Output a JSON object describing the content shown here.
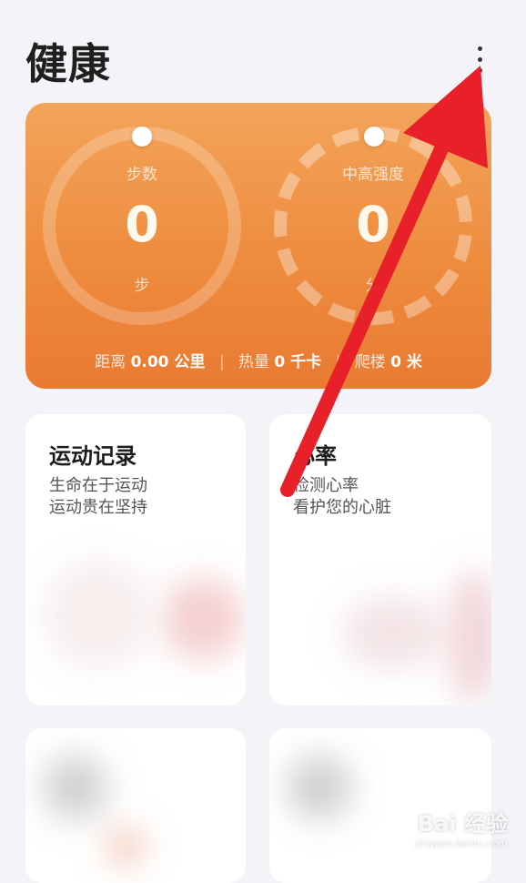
{
  "header": {
    "title": "健康"
  },
  "summary": {
    "steps": {
      "label": "步数",
      "value": "0",
      "unit": "步"
    },
    "intense": {
      "label": "中高强度",
      "value": "0",
      "unit": "分"
    },
    "stats": {
      "distance_label": "距离",
      "distance_value": "0.00 公里",
      "calories_label": "热量",
      "calories_value": "0 千卡",
      "climb_label": "爬楼",
      "climb_value": "0 米"
    }
  },
  "tiles": {
    "exercise": {
      "title": "运动记录",
      "line1": "生命在于运动",
      "line2": "运动贵在坚持"
    },
    "heart": {
      "title": "心率",
      "line1": "检测心率",
      "line2": "看护您的心脏"
    }
  },
  "watermark": {
    "main": "Bai 经验",
    "sub": "jingyan.baidu.com"
  },
  "colors": {
    "accent": "#ee8c3e",
    "arrow": "#e8202a"
  }
}
